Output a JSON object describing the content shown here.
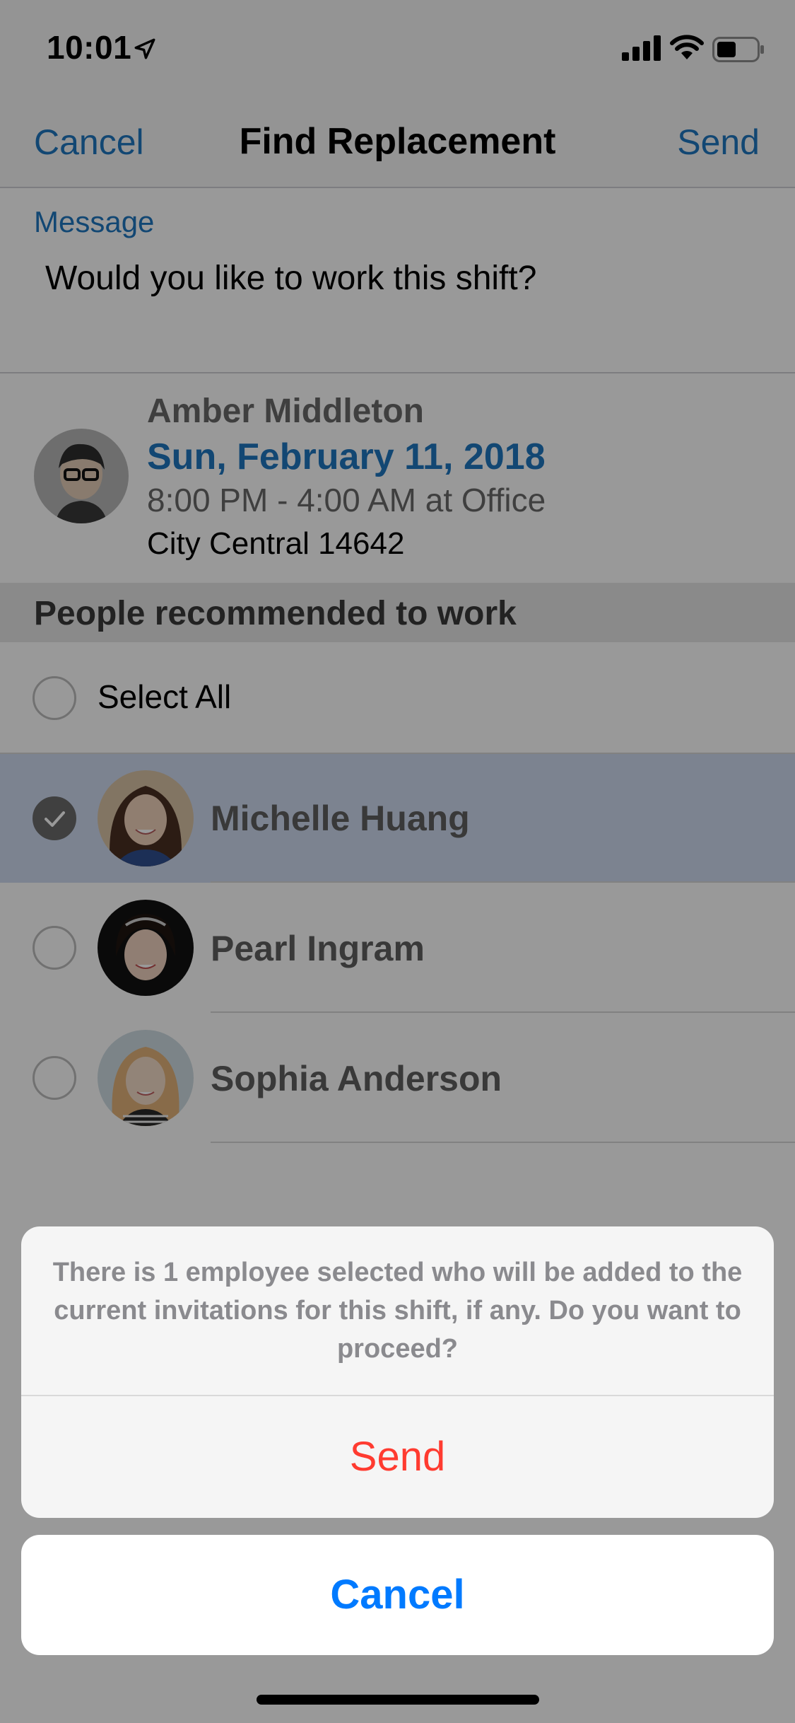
{
  "status_bar": {
    "time": "10:01",
    "icons": [
      "location-arrow-icon",
      "cellular-signal-icon",
      "wifi-icon",
      "battery-icon"
    ]
  },
  "nav": {
    "cancel_label": "Cancel",
    "title": "Find Replacement",
    "send_label": "Send"
  },
  "message": {
    "label": "Message",
    "text": "Would you like to work this shift?"
  },
  "shift": {
    "employee_name": "Amber Middleton",
    "date": "Sun, February 11, 2018",
    "time": "8:00 PM - 4:00 AM at Office",
    "location": "City Central 14642"
  },
  "recommended": {
    "header": "People recommended to work",
    "select_all_label": "Select All",
    "people": [
      {
        "name": "Michelle Huang",
        "selected": true
      },
      {
        "name": "Pearl Ingram",
        "selected": false
      },
      {
        "name": "Sophia Anderson",
        "selected": false
      }
    ]
  },
  "action_sheet": {
    "message": "There is 1 employee selected who will be added to the current invitations for this shift, if any. Do you want to proceed?",
    "send_label": "Send",
    "cancel_label": "Cancel"
  },
  "colors": {
    "accent": "#1f77c0",
    "destructive": "#ff3b30",
    "cancel_blue": "#007aff",
    "selected_row": "#cfdaf0"
  }
}
